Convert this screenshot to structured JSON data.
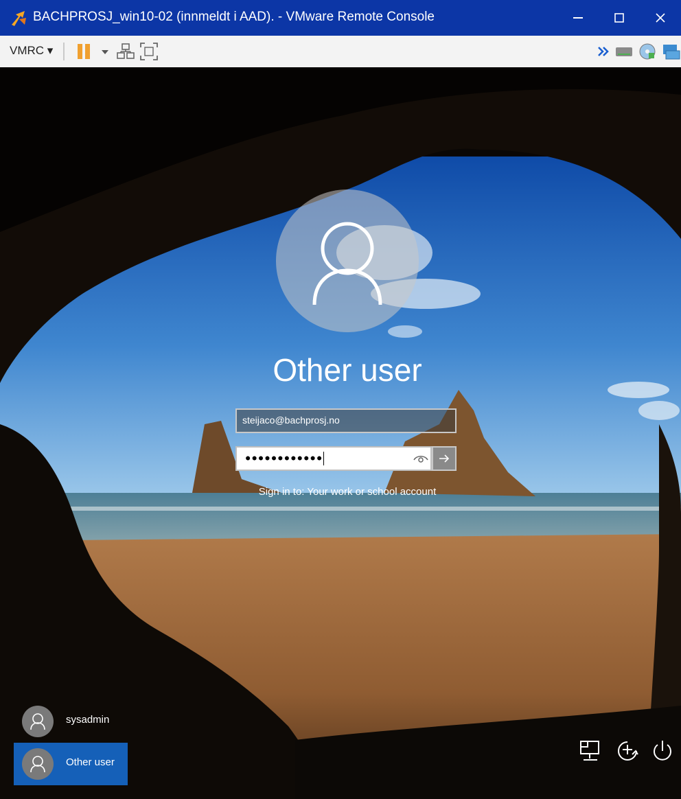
{
  "window": {
    "title": "BACHPROSJ_win10-02 (innmeldt i AAD). - VMware Remote Console",
    "icons": [
      "vmware-remote-console-icon",
      "minimize-icon",
      "maximize-icon",
      "close-icon"
    ]
  },
  "toolbar": {
    "vmrc_label": "VMRC ▾",
    "icons": [
      "pause-icon",
      "dropdown-icon",
      "network-adapter-icon",
      "fullscreen-icon",
      "expand-icon",
      "removable-device-icon",
      "cd-drive-icon",
      "display-icon"
    ]
  },
  "login": {
    "user_title": "Other user",
    "username_value": "steijaco@bachprosj.no",
    "password_mask": "●●●●●●●●●●●●",
    "sign_in_to": "Sign in to: Your work or school account"
  },
  "users": [
    {
      "name": "sysadmin",
      "selected": false
    },
    {
      "name": "Other user",
      "selected": true
    }
  ],
  "system_icons": [
    "network-icon",
    "ease-of-access-icon",
    "power-icon"
  ],
  "colors": {
    "titlebar": "#0c36a6",
    "selected_user": "#1560b8"
  }
}
